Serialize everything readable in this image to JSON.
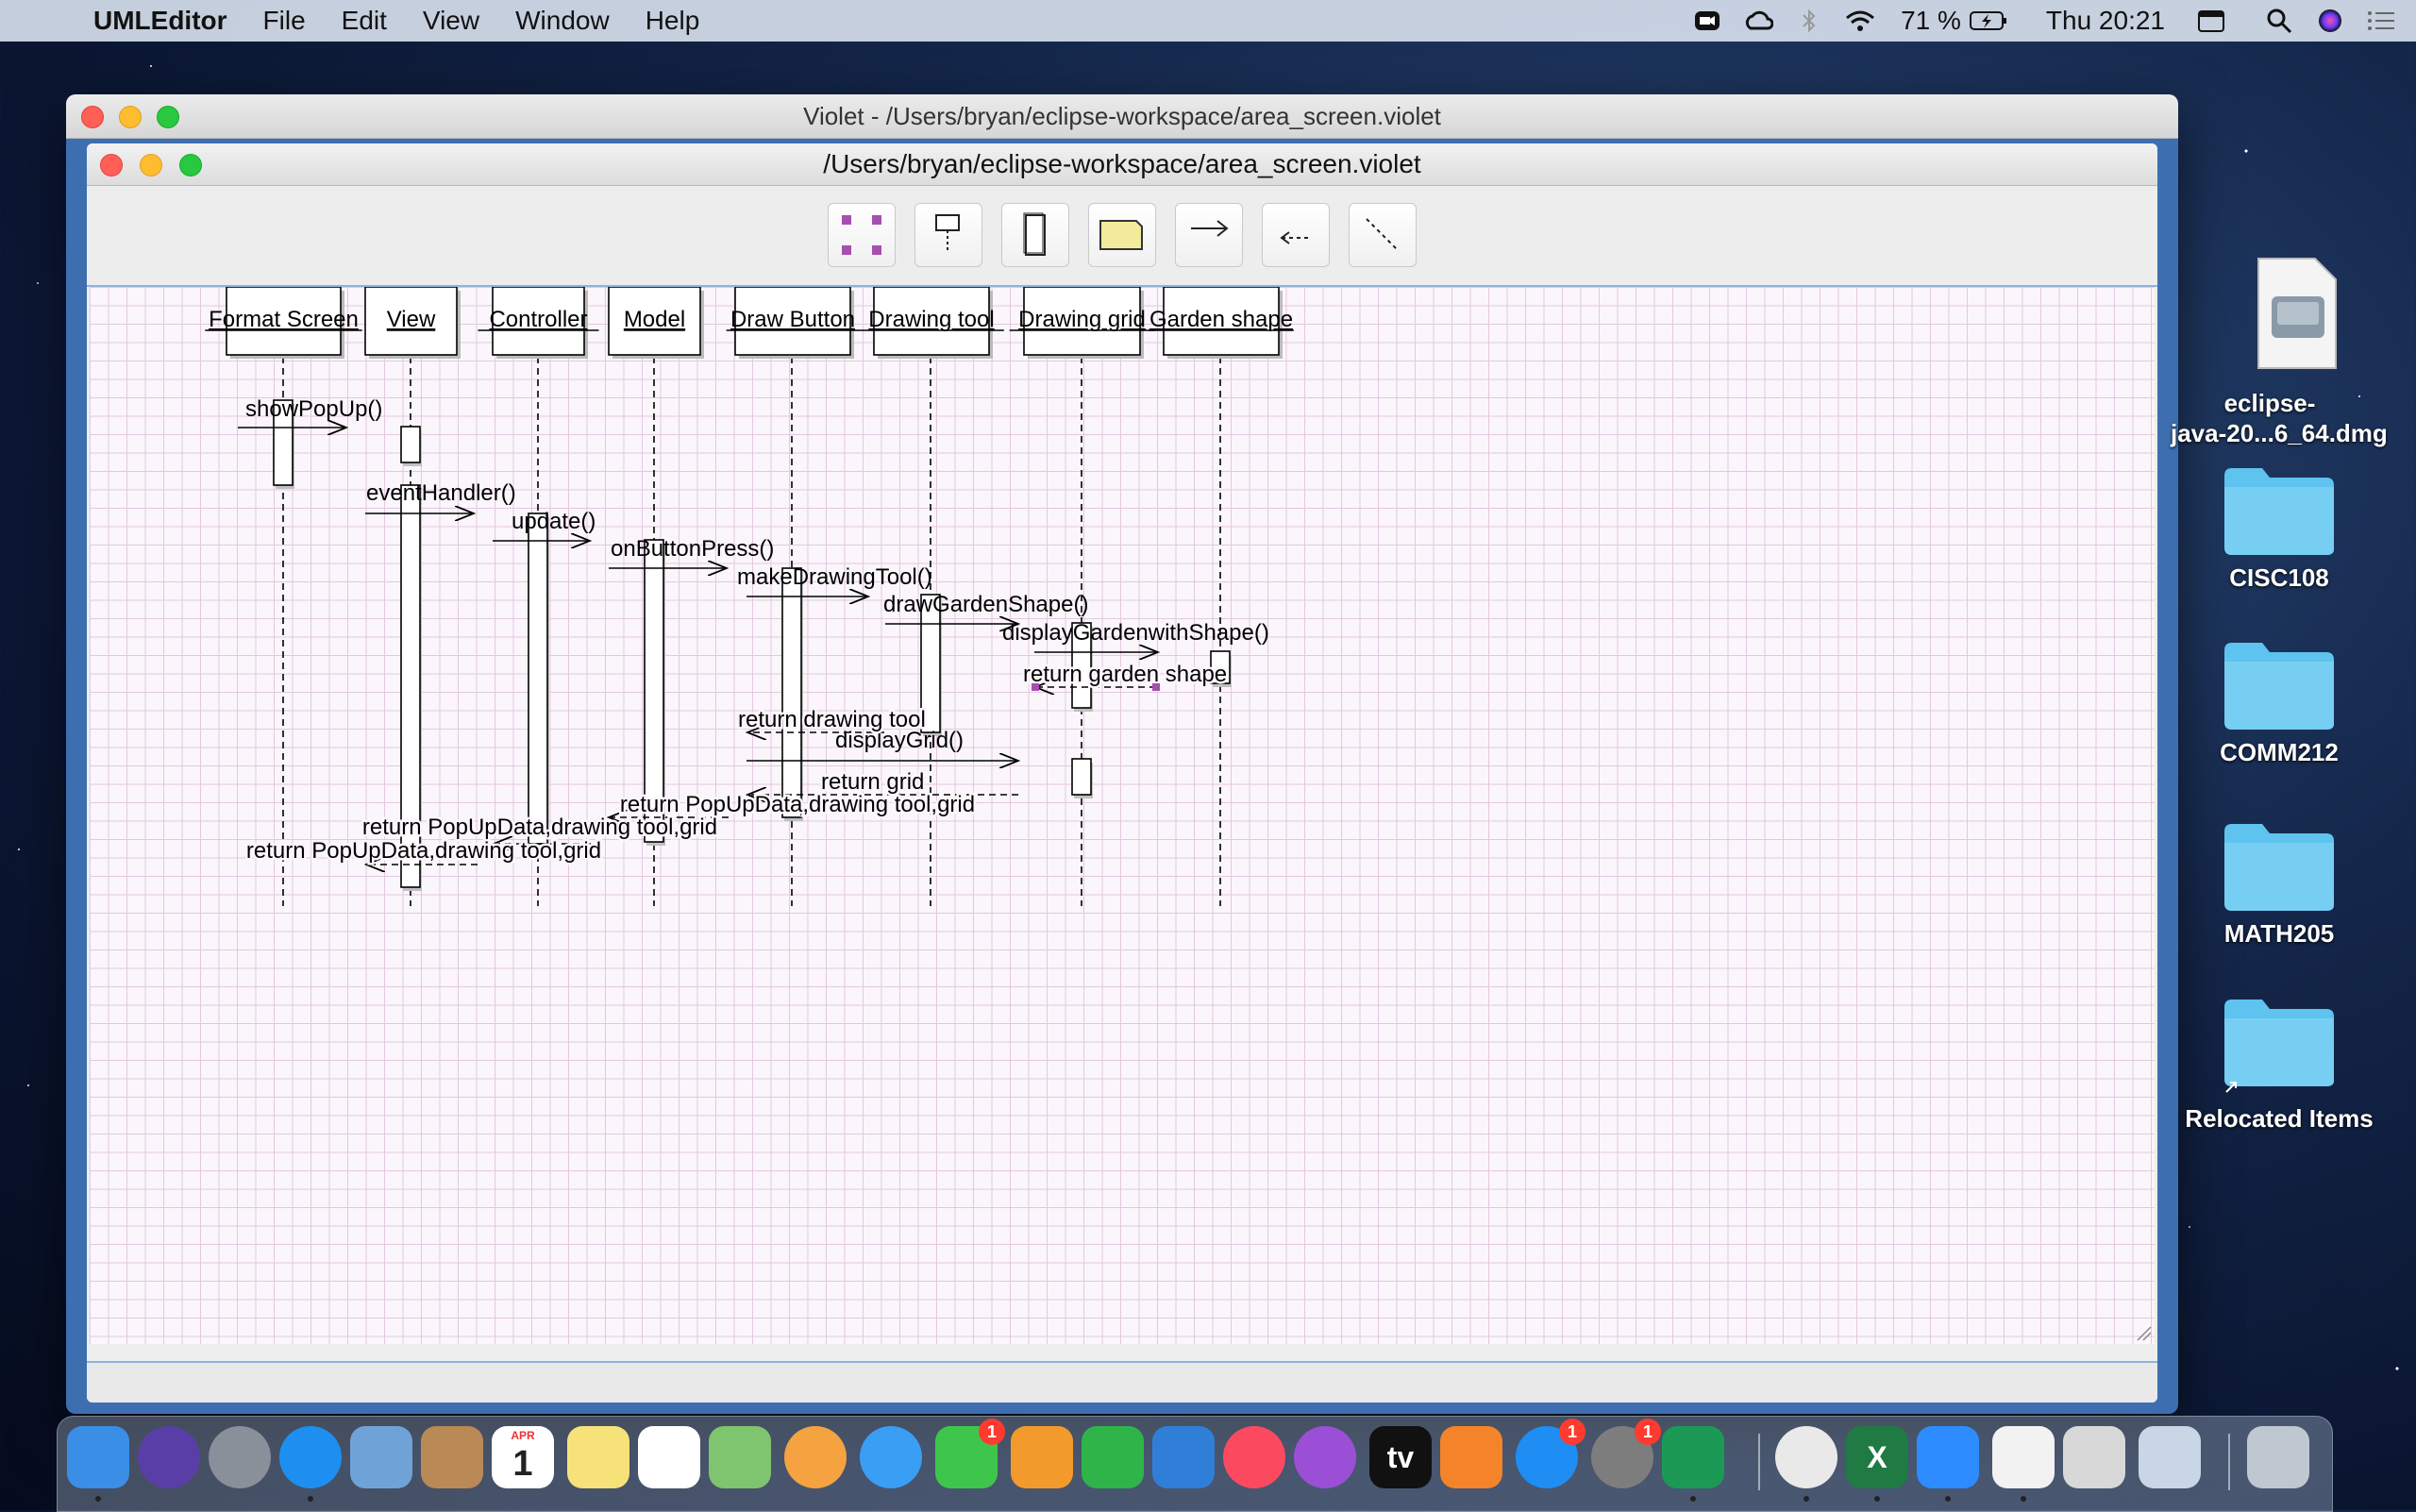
{
  "menubar": {
    "app": "UMLEditor",
    "items": [
      "File",
      "Edit",
      "View",
      "Window",
      "Help"
    ],
    "battery": "71 %",
    "clock": "Thu 20:21"
  },
  "outer_window": {
    "title": "Violet - /Users/bryan/eclipse-workspace/area_screen.violet"
  },
  "inner_window": {
    "title": "/Users/bryan/eclipse-workspace/area_screen.violet"
  },
  "toolbar": {
    "tools": [
      "select-tool",
      "implicit-parameter-tool",
      "call-node-tool",
      "note-tool",
      "call-edge-tool",
      "return-edge-tool",
      "note-connector-tool"
    ]
  },
  "diagram": {
    "objects": [
      "Format Screen",
      "View",
      "Controller",
      "Model",
      "Draw Button",
      "Drawing tool",
      "Drawing grid",
      "Garden shape"
    ],
    "calls": [
      {
        "label": "showPopUp()",
        "from": 0,
        "to": 1
      },
      {
        "label": "eventHandler()",
        "from": 1,
        "to": 2
      },
      {
        "label": "update()",
        "from": 2,
        "to": 3
      },
      {
        "label": "onButtonPress()",
        "from": 3,
        "to": 4
      },
      {
        "label": "makeDrawingTool()",
        "from": 4,
        "to": 5
      },
      {
        "label": "drawGardenShape()",
        "from": 5,
        "to": 6
      },
      {
        "label": "displayGardenwithShape()",
        "from": 6,
        "to": 7
      },
      {
        "label": "displayGrid()",
        "from": 4,
        "to": 6
      }
    ],
    "returns": [
      {
        "label": "return garden shape",
        "from": 7,
        "to": 6
      },
      {
        "label": "return drawing tool",
        "from": 5,
        "to": 4
      },
      {
        "label": "return grid",
        "from": 6,
        "to": 4
      },
      {
        "label": "return PopUpData,drawing tool,grid",
        "from": 4,
        "to": 3
      },
      {
        "label": "return PopUpData,drawing tool,grid",
        "from": 3,
        "to": 2
      },
      {
        "label": "return PopUpData,drawing tool,grid",
        "from": 2,
        "to": 1
      }
    ]
  },
  "desktop": {
    "items": [
      {
        "label": "eclipse-\njava-20...6_64.dmg",
        "kind": "disk-image"
      },
      {
        "label": "CISC108",
        "kind": "folder"
      },
      {
        "label": "COMM212",
        "kind": "folder"
      },
      {
        "label": "MATH205",
        "kind": "folder"
      },
      {
        "label": "Relocated Items",
        "kind": "folder-alias"
      }
    ]
  },
  "dock": {
    "apps": [
      {
        "name": "finder-icon",
        "color": "#3a8ee6"
      },
      {
        "name": "siri-icon",
        "color": "#5a3ea8"
      },
      {
        "name": "launchpad-icon",
        "color": "#8a9099"
      },
      {
        "name": "safari-icon",
        "color": "#1d8ff0"
      },
      {
        "name": "mail-stamp-icon",
        "color": "#6fa3d8"
      },
      {
        "name": "contacts-icon",
        "color": "#b98a56"
      },
      {
        "name": "calendar-icon",
        "color": "#ffffff",
        "label": "1",
        "sublabel": "APR"
      },
      {
        "name": "notes-icon",
        "color": "#f7e27a"
      },
      {
        "name": "reminders-icon",
        "color": "#ffffff"
      },
      {
        "name": "maps-icon",
        "color": "#7fc46e"
      },
      {
        "name": "photos-icon",
        "color": "#f4a340"
      },
      {
        "name": "messages-icon",
        "color": "#3a9ef5"
      },
      {
        "name": "facetime-icon",
        "color": "#3ec64c",
        "badge": "1"
      },
      {
        "name": "pages-icon",
        "color": "#f39a2c"
      },
      {
        "name": "numbers-icon",
        "color": "#2fb44a"
      },
      {
        "name": "keynote-icon",
        "color": "#2f7fd8"
      },
      {
        "name": "music-icon",
        "color": "#fb4a60"
      },
      {
        "name": "podcasts-icon",
        "color": "#9b4fd6"
      },
      {
        "name": "apple-tv-icon",
        "color": "#111111",
        "label": "tv"
      },
      {
        "name": "books-icon",
        "color": "#f4832a"
      },
      {
        "name": "app-store-icon",
        "color": "#1e8ef4",
        "badge": "1"
      },
      {
        "name": "system-preferences-icon",
        "color": "#7d7d7d",
        "badge": "1"
      },
      {
        "name": "android-studio-icon",
        "color": "#1c9a55"
      },
      {
        "name": "chrome-icon",
        "color": "#e9e9e9"
      },
      {
        "name": "excel-icon",
        "color": "#1f7a44",
        "label": "X"
      },
      {
        "name": "zoom-icon",
        "color": "#2d8cff"
      },
      {
        "name": "java-icon",
        "color": "#f2f2f2"
      },
      {
        "name": "preview-icon",
        "color": "#d8d8d8"
      },
      {
        "name": "screenshot-icon",
        "color": "#c9d6e6"
      },
      {
        "name": "trash-icon",
        "color": "#bfc7d1"
      }
    ]
  }
}
